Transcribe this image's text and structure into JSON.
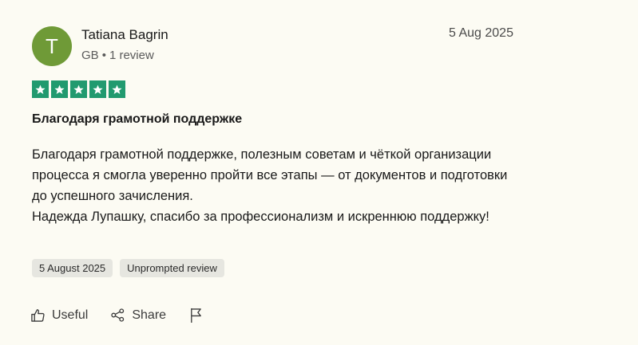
{
  "review": {
    "author": {
      "initial": "T",
      "name": "Tatiana Bagrin",
      "country": "GB",
      "separator": "•",
      "review_count": "1 review"
    },
    "date_short": "5 Aug 2025",
    "rating": {
      "stars": 5,
      "max": 5,
      "color": "#219a6f"
    },
    "title": "Благодаря грамотной поддержке",
    "body_lines": [
      "Благодаря грамотной поддержке, полезным советам и чёткой организации процесса я смогла уверенно пройти все этапы — от документов и подготовки до успешного зачисления.",
      "Надежда Лупашку, спасибо за профессионализм и искреннюю поддержку!"
    ],
    "tags": [
      "5 August 2025",
      "Unprompted review"
    ]
  },
  "actions": {
    "useful_label": "Useful",
    "useful_icon": "thumbs-up-icon",
    "share_label": "Share",
    "share_icon": "share-icon",
    "report_icon": "flag-icon"
  },
  "colors": {
    "avatar": "#6f9a37",
    "background": "#fcfbf3",
    "tag_background": "#e6e6e0"
  }
}
